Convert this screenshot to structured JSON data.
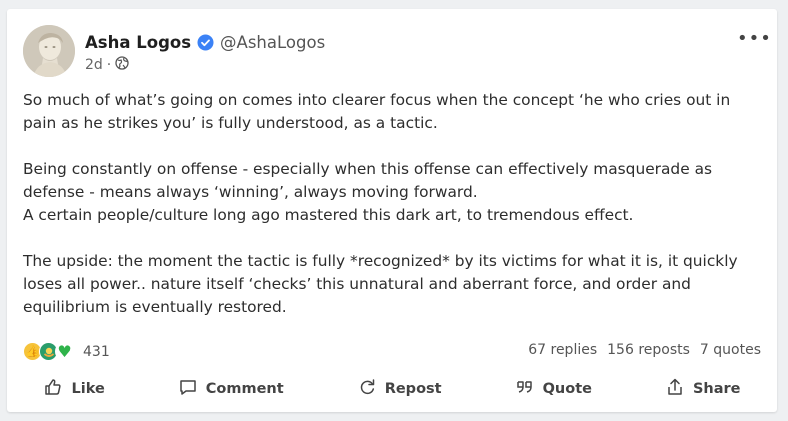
{
  "post": {
    "author": {
      "display_name": "Asha Logos",
      "handle": "@AshaLogos",
      "verified": true
    },
    "time": "2d",
    "separator": "·",
    "visibility_icon": "globe-icon",
    "menu_icon": "more-options-icon",
    "menu_label": "•••",
    "paragraphs": [
      "So much of what’s going on comes into clearer focus when the concept ‘he who cries out in pain as he strikes you’ is fully understood, as a tactic.",
      "Being constantly on offense - especially when this offense can effectively masquerade as defense - means always ‘winning’, always moving forward.",
      "A certain people/culture long ago mastered this dark art, to tremendous effect.",
      "The upside: the moment the tactic is fully *recognized* by its victims for what it is, it quickly loses all power.. nature itself ‘checks’ this unnatural and aberrant force, and order and equilibrium is eventually restored."
    ]
  },
  "stats": {
    "reaction_icons": [
      "thumbs-up-icon",
      "hug-icon",
      "green-heart-icon"
    ],
    "reaction_count": "431",
    "replies": "67 replies",
    "reposts": "156 reposts",
    "quotes": "7 quotes"
  },
  "actions": {
    "like": "Like",
    "comment": "Comment",
    "repost": "Repost",
    "quote": "Quote",
    "share": "Share"
  },
  "colors": {
    "verified_badge": "#3b82f6",
    "accent_text": "#2d2d2d",
    "background": "#eef0f2"
  }
}
